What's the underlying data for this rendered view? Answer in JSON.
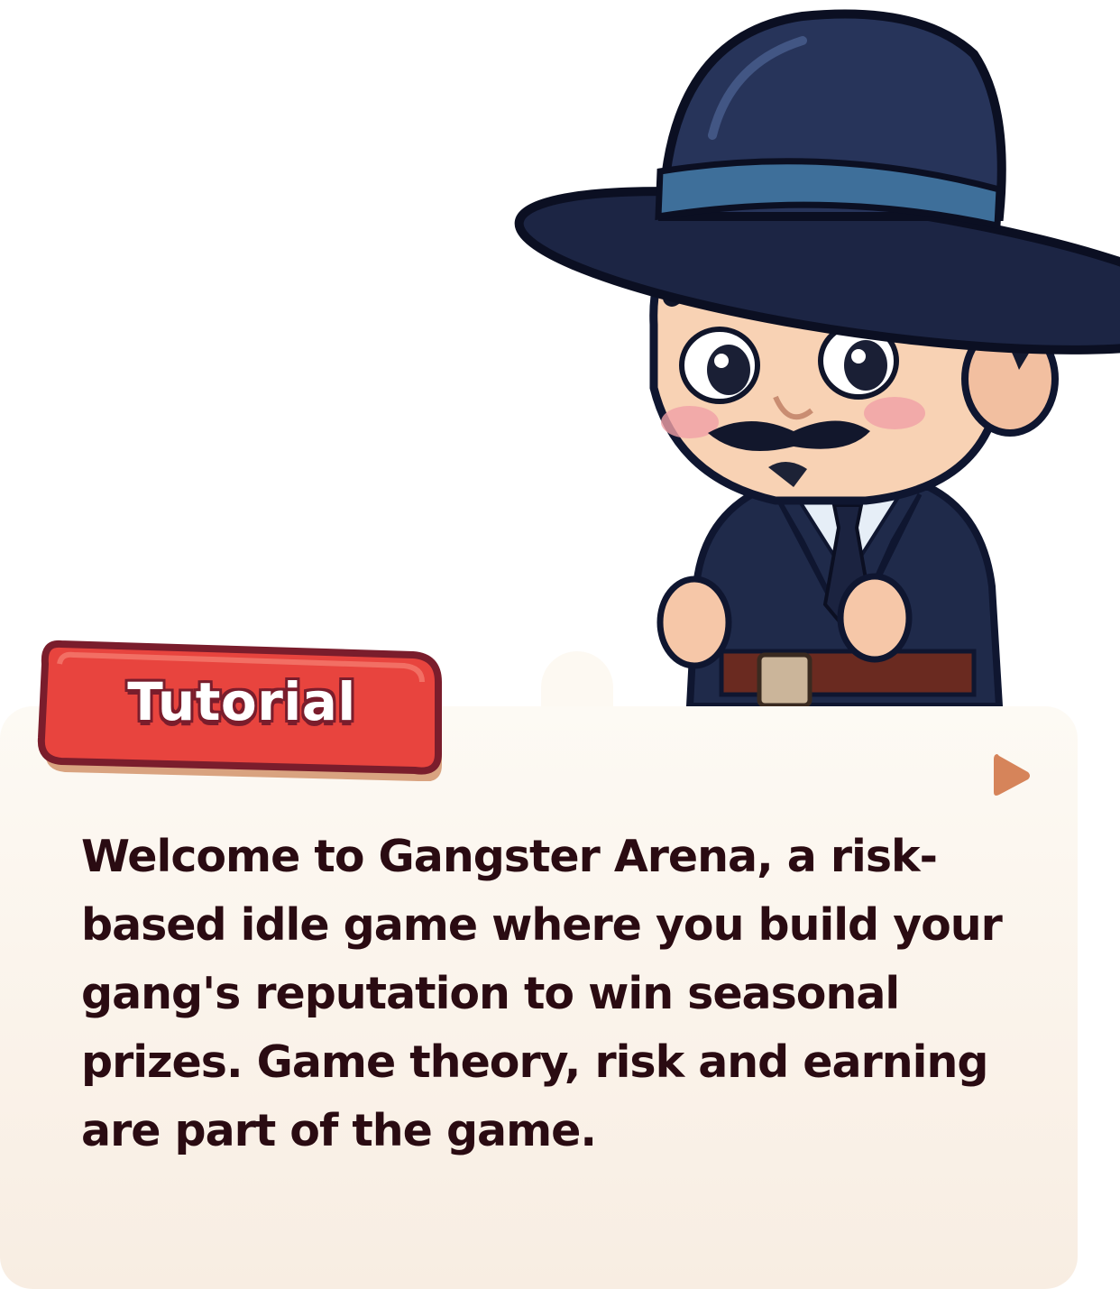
{
  "tutorial": {
    "title": "Tutorial",
    "message": "Welcome to Gangster Arena, a risk-based idle game where you build your gang's reputation to win seasonal prizes. Game theory, risk and earning are part of the game.",
    "next_icon": "play-triangle"
  },
  "colors": {
    "banner_red": "#e8443e",
    "banner_outline": "#7a1d2c",
    "panel_bg": "#fbf4ea",
    "text_dark": "#2a0b12",
    "arrow": "#d6845a"
  }
}
